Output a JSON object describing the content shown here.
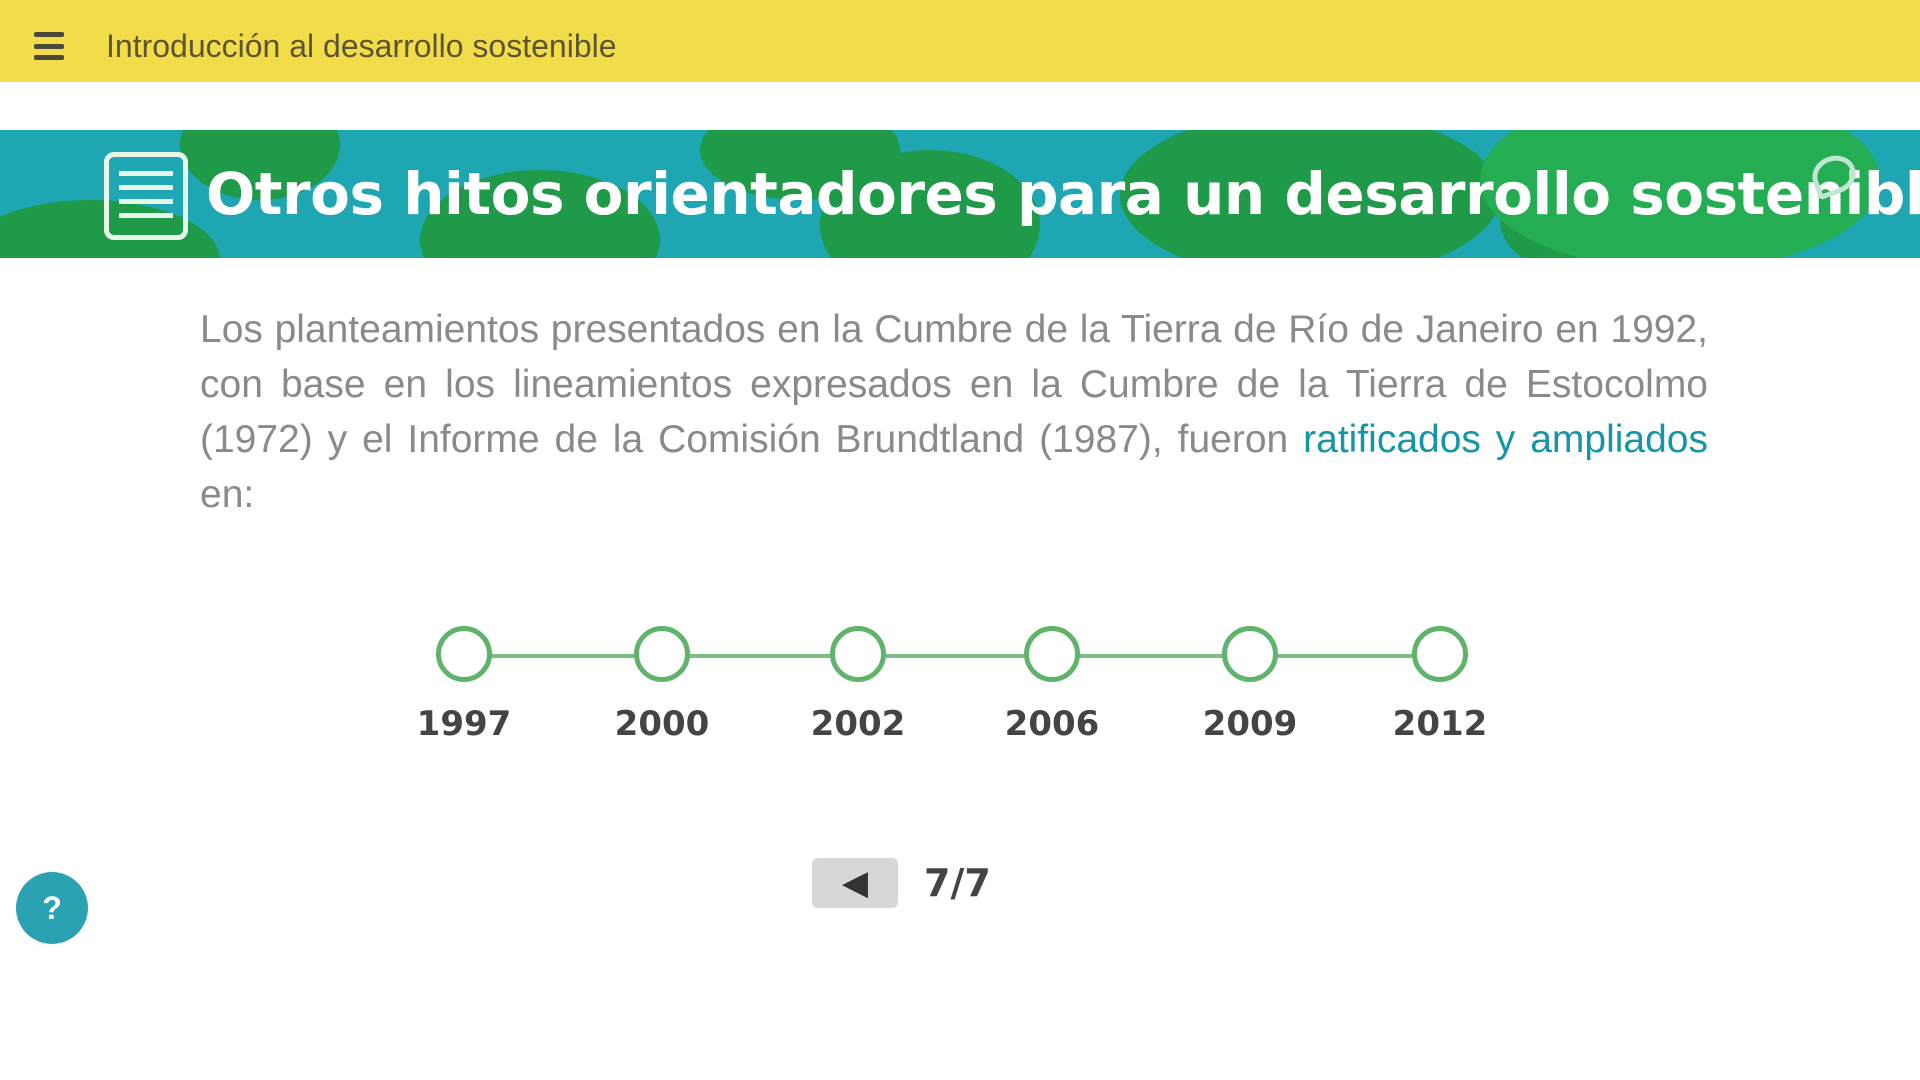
{
  "header": {
    "course_title": "Introducción al desarrollo sostenible",
    "menu_icon": "hamburger-menu-icon",
    "background_color": "#f2dc4a"
  },
  "banner": {
    "title": "Otros hitos orientadores para un desarrollo sostenible",
    "icon": "document-icon",
    "decorative_icon": "leaf-icon",
    "colors": {
      "teal": "#1ea6b3",
      "green": "#1e9a48"
    }
  },
  "intro": {
    "text": "Los planteamientos presentados en la Cumbre de la Tierra de Río de Janeiro en 1992, con base en los lineamientos expresados en la Cumbre de la Tierra de Estocolmo (1972) y el Informe de la Comisión Brundtland (1987), fueron",
    "link_text": "ratificados y ampliados",
    "suffix": "en:"
  },
  "timeline": {
    "items": [
      {
        "year": "1997"
      },
      {
        "year": "2000"
      },
      {
        "year": "2002"
      },
      {
        "year": "2006"
      },
      {
        "year": "2009"
      },
      {
        "year": "2012"
      }
    ],
    "accent_color": "#5fb36a"
  },
  "pager": {
    "prev_icon": "arrow-left-icon",
    "prev_glyph": "◀",
    "page_indicator": "7/7"
  },
  "help": {
    "icon": "help-icon",
    "glyph": "?"
  }
}
